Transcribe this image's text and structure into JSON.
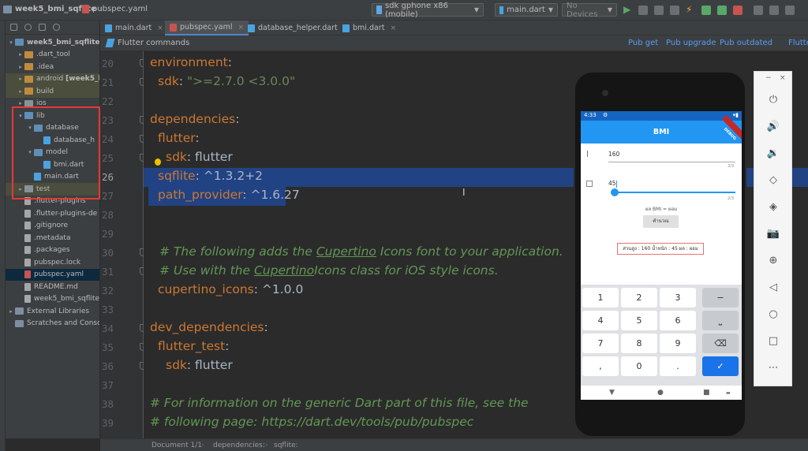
{
  "topbar": {
    "project": "week5_bmi_sqflite",
    "file": "pubspec.yaml",
    "device": "sdk gphone x86 (mobile)",
    "run_config": "main.dart",
    "devices": "No Devices"
  },
  "project_tree": [
    {
      "label": "week5_bmi_sqflite",
      "suffix": "C",
      "type": "folder-b",
      "arrow": "▾",
      "indent": 0
    },
    {
      "label": ".dart_tool",
      "type": "folder-o",
      "arrow": "▸",
      "indent": 1
    },
    {
      "label": ".idea",
      "type": "folder-o",
      "arrow": "▸",
      "indent": 1
    },
    {
      "label": "android",
      "bold": "[week5_b",
      "type": "folder-o",
      "arrow": "▸",
      "indent": 1
    },
    {
      "label": "build",
      "type": "folder-o",
      "arrow": "▸",
      "indent": 1
    },
    {
      "label": "ios",
      "type": "folder",
      "arrow": "▸",
      "indent": 1
    },
    {
      "label": "lib",
      "type": "folder-b",
      "arrow": "▾",
      "indent": 1
    },
    {
      "label": "database",
      "type": "folder-b",
      "arrow": "▾",
      "indent": 2
    },
    {
      "label": "database_h",
      "type": "dart",
      "arrow": "",
      "indent": 3
    },
    {
      "label": "model",
      "type": "folder-b",
      "arrow": "▾",
      "indent": 2
    },
    {
      "label": "bmi.dart",
      "type": "dart",
      "arrow": "",
      "indent": 3
    },
    {
      "label": "main.dart",
      "type": "dart",
      "arrow": "",
      "indent": 2
    },
    {
      "label": "test",
      "type": "folder",
      "arrow": "▸",
      "indent": 1
    },
    {
      "label": ".flutter-plugins",
      "type": "file",
      "arrow": "",
      "indent": 1
    },
    {
      "label": ".flutter-plugins-de",
      "type": "file",
      "arrow": "",
      "indent": 1
    },
    {
      "label": ".gitignore",
      "type": "file",
      "arrow": "",
      "indent": 1
    },
    {
      "label": ".metadata",
      "type": "file",
      "arrow": "",
      "indent": 1
    },
    {
      "label": ".packages",
      "type": "file",
      "arrow": "",
      "indent": 1
    },
    {
      "label": "pubspec.lock",
      "type": "file",
      "arrow": "",
      "indent": 1
    },
    {
      "label": "pubspec.yaml",
      "type": "yaml",
      "arrow": "",
      "indent": 1
    },
    {
      "label": "README.md",
      "type": "file",
      "arrow": "",
      "indent": 1
    },
    {
      "label": "week5_bmi_sqflite",
      "type": "file",
      "arrow": "",
      "indent": 1
    },
    {
      "label": "External Libraries",
      "type": "lib",
      "arrow": "▸",
      "indent": 0
    },
    {
      "label": "Scratches and Consol",
      "type": "lib",
      "arrow": "",
      "indent": 0
    }
  ],
  "tabs": [
    {
      "label": "main.dart",
      "icon": "dart"
    },
    {
      "label": "pubspec.yaml",
      "icon": "yaml",
      "active": true
    },
    {
      "label": "database_helper.dart",
      "icon": "dart"
    },
    {
      "label": "bmi.dart",
      "icon": "dart"
    }
  ],
  "flutter_bar": {
    "title": "Flutter commands",
    "pub_get": "Pub get",
    "pub_upgrade": "Pub upgrade",
    "pub_outdated": "Pub outdated",
    "flutter": "Flutter"
  },
  "line_numbers": [
    "20",
    "21",
    "22",
    "23",
    "24",
    "25",
    "26",
    "27",
    "28",
    "29",
    "30",
    "31",
    "32",
    "33",
    "34",
    "35",
    "36",
    "37",
    "38",
    "39"
  ],
  "code": {
    "l20_key": "environment",
    "l21_key": "sdk",
    "l21_val": "\">=2.7.0 <3.0.0\"",
    "l23_key": "dependencies",
    "l24_key": "flutter",
    "l25_key": "sdk",
    "l25_val": "flutter",
    "l26_key": "sqflite",
    "l26_val": "^1.3.2+2",
    "l27_key": "path_provider",
    "l27_val": "^1.6.27",
    "l30_c1": "# The following adds the ",
    "l30_c2": "Cupertino",
    "l30_c3": " Icons font to your application.",
    "l31_c1": "# Use with the ",
    "l31_c2": "Cupertino",
    "l31_c3": "Icons class for iOS style icons.",
    "l32_key": "cupertino_icons",
    "l32_val": "^1.0.0",
    "l34_key": "dev_dependencies",
    "l35_key": "flutter_test",
    "l36_key": "sdk",
    "l36_val": "flutter",
    "l38_c": "# For information on the generic Dart part of this file, see the",
    "l39_c": "# following page: https://dart.dev/tools/pub/pubspec"
  },
  "statusbar": {
    "doc": "Document 1/1",
    "path1": "dependencies:",
    "path2": "sqflite:"
  },
  "phone": {
    "time": "4:33",
    "app_title": "BMI",
    "debug_label": "DEBUG",
    "height_value": "160",
    "height_counter": "3/3",
    "weight_value": "45",
    "weight_counter": "2/3",
    "bmi_label": "ผล BMI = ผอม",
    "calc_button": "คำนวณ",
    "result": "ส่วนสูง : 160  น้ำหนัก : 45 ผล : ผอม",
    "keys": [
      "1",
      "2",
      "3",
      "−",
      "4",
      "5",
      "6",
      "⎵",
      "7",
      "8",
      "9",
      "⌫",
      ",",
      "0",
      ".",
      "✓"
    ],
    "nav": [
      "▼",
      "●",
      "■",
      "▬"
    ]
  },
  "emulator_panel": {
    "minimize": "−",
    "close": "×",
    "buttons": [
      "⏻",
      "🔊",
      "🔉",
      "◇",
      "◈",
      "📷",
      "⊕",
      "◁",
      "○",
      "□",
      "⋯"
    ]
  }
}
